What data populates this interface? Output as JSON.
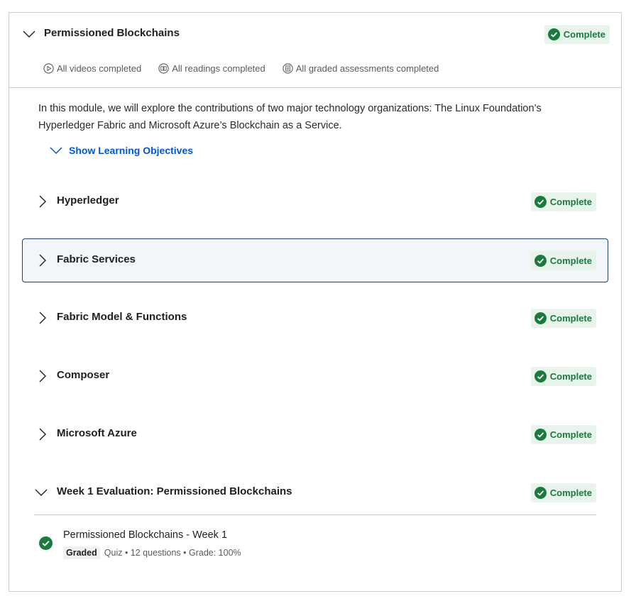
{
  "module": {
    "title": "Permissioned Blockchains",
    "status": "Complete",
    "summary": {
      "videos": "All videos completed",
      "readings": "All readings completed",
      "assessments": "All graded assessments completed"
    },
    "description": "In this module, we will explore the contributions of two major technology organizations: The Linux Foundation’s Hyperledger Fabric and Microsoft Azure’s Blockchain as a Service.",
    "objectives_label": "Show Learning Objectives"
  },
  "lessons": [
    {
      "name": "Hyperledger",
      "status": "Complete"
    },
    {
      "name": "Fabric Services",
      "status": "Complete"
    },
    {
      "name": "Fabric Model & Functions",
      "status": "Complete"
    },
    {
      "name": "Composer",
      "status": "Complete"
    },
    {
      "name": "Microsoft Azure",
      "status": "Complete"
    },
    {
      "name": "Week 1 Evaluation: Permissioned Blockchains",
      "status": "Complete"
    }
  ],
  "evaluation_item": {
    "title": "Permissioned Blockchains - Week 1",
    "tag": "Graded",
    "details": "Quiz • 12 questions • Grade: 100%"
  },
  "colors": {
    "accent": "#0056d2",
    "success": "#1b7a3d",
    "success_bg": "#e8f3ec",
    "selected_border": "#1f3f66"
  },
  "icons": {
    "expand": "chevron-down-icon",
    "collapsed": "chevron-right-icon",
    "status": "check-circle-icon",
    "videos": "play-circle-icon",
    "readings": "book-open-icon",
    "assessments": "assessment-list-icon"
  }
}
